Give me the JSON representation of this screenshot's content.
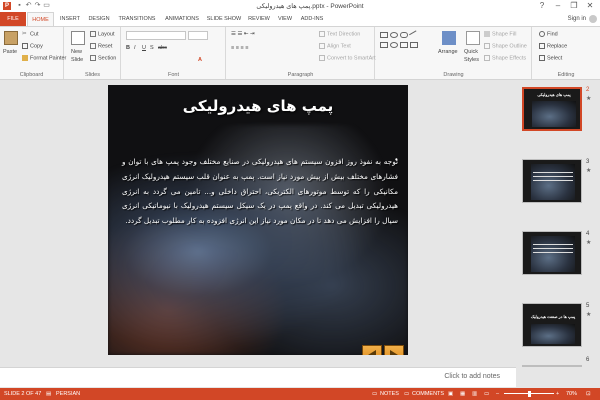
{
  "window": {
    "title": "پمپ های هیدرولیکی.pptx - PowerPoint",
    "app_icon": "P",
    "icons": [
      "save-icon",
      "undo-icon",
      "redo-icon",
      "slideshow-icon"
    ],
    "controls": [
      "?",
      "–",
      "❐",
      "✕"
    ]
  },
  "tabs": [
    "FILE",
    "HOME",
    "INSERT",
    "DESIGN",
    "TRANSITIONS",
    "ANIMATIONS",
    "SLIDE SHOW",
    "REVIEW",
    "VIEW",
    "ADD-INS"
  ],
  "signin": "Sign in",
  "ribbon": {
    "clipboard": {
      "label": "Clipboard",
      "paste": "Paste",
      "cut": "Cut",
      "copy": "Copy",
      "format_painter": "Format Painter"
    },
    "slides": {
      "label": "Slides",
      "new_slide": "New",
      "new_slide2": "Slide",
      "layout": "Layout",
      "reset": "Reset",
      "section": "Section"
    },
    "font": {
      "label": "Font"
    },
    "paragraph": {
      "label": "Paragraph",
      "text_direction": "Text Direction",
      "align_text": "Align Text",
      "convert_smartart": "Convert to SmartArt"
    },
    "drawing": {
      "label": "Drawing",
      "arrange": "Arrange",
      "quick_styles": "Quick",
      "quick_styles2": "Styles",
      "shape_fill": "Shape Fill",
      "shape_outline": "Shape Outline",
      "shape_effects": "Shape Effects"
    },
    "editing": {
      "label": "Editing",
      "find": "Find",
      "replace": "Replace",
      "select": "Select"
    }
  },
  "slide": {
    "title": "پمپ های هیدرولیکی",
    "bullet": "•",
    "body": "توجه به نفوذ روز افزون سیستم های هیدرولیکی در صنایع مختلف وجود پمپ های با توان و فشارهای مختلف بیش از پیش مورد نیاز است. پمپ به عنوان قلب سیستم هیدرولیک انرژی مکانیکی را که توسط موتورهای الکتریکی، احتراق داخلی و... تامین می گردد به انرژی هیدرولیکی تبدیل می کند. در واقع پمپ در یک سیکل سیستم هیدرولیک با نیوماتیکی انرژی سیال را افزایش می دهد تا در مکان مورد نیاز این انرژی افزوده به کار مطلوب تبدیل گردد."
  },
  "thumbnails": [
    {
      "num": "2",
      "title": "پمپ های هیدرولیکی",
      "selected": true
    },
    {
      "num": "3",
      "title": ""
    },
    {
      "num": "4",
      "title": ""
    },
    {
      "num": "5",
      "title": "پمپ ها در صنعت هیدرولیک"
    },
    {
      "num": "6",
      "title": ""
    }
  ],
  "notes_placeholder": "Click to add notes",
  "status": {
    "slide": "SLIDE 2 OF 47",
    "language": "PERSIAN",
    "notes": "NOTES",
    "comments": "COMMENTS",
    "zoom": "70%"
  },
  "colors": {
    "accent": "#d24726",
    "slide_bg": "#101012",
    "nav_button": "#e99a2a"
  }
}
